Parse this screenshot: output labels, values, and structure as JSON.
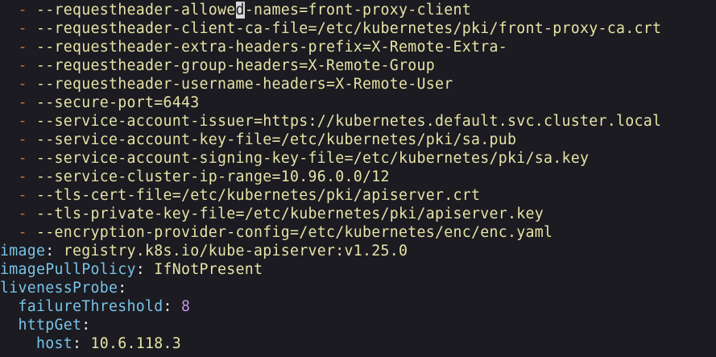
{
  "colors": {
    "background": "#1b1b21",
    "list_dash": "#cc6a35",
    "string_value": "#e7e3a6",
    "yaml_key": "#78c4e8",
    "number": "#c693e6",
    "plain_text": "#eeeeea",
    "cursor": "#d9d9d9"
  },
  "command_args": {
    "dash": "-",
    "first_arg": {
      "before_cursor": "--requestheader-allowe",
      "cursor_char": "d",
      "after_cursor": "-names=front-proxy-client"
    },
    "items": [
      "--requestheader-client-ca-file=/etc/kubernetes/pki/front-proxy-ca.crt",
      "--requestheader-extra-headers-prefix=X-Remote-Extra-",
      "--requestheader-group-headers=X-Remote-Group",
      "--requestheader-username-headers=X-Remote-User",
      "--secure-port=6443",
      "--service-account-issuer=https://kubernetes.default.svc.cluster.local",
      "--service-account-key-file=/etc/kubernetes/pki/sa.pub",
      "--service-account-signing-key-file=/etc/kubernetes/pki/sa.key",
      "--service-cluster-ip-range=10.96.0.0/12",
      "--tls-cert-file=/etc/kubernetes/pki/apiserver.crt",
      "--tls-private-key-file=/etc/kubernetes/pki/apiserver.key",
      "--encryption-provider-config=/etc/kubernetes/enc/enc.yaml"
    ]
  },
  "container": {
    "image_key": "image",
    "image_value": "registry.k8s.io/kube-apiserver:v1.25.0",
    "pull_policy_key": "imagePullPolicy",
    "pull_policy_value": "IfNotPresent",
    "liveness_key": "livenessProbe",
    "failure_threshold_key": "failureThreshold",
    "failure_threshold_value": "8",
    "http_get_key": "httpGet",
    "host_key": "host",
    "host_value": "10.6.118.3"
  }
}
